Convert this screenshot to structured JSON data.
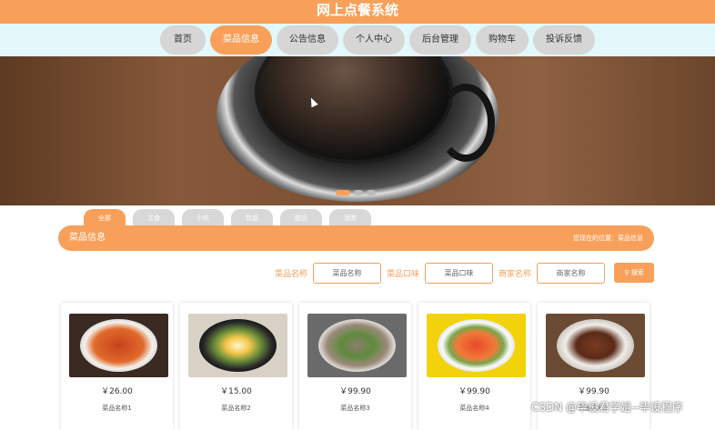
{
  "app_title": "网上点餐系统",
  "nav": {
    "items": [
      {
        "label": "首页"
      },
      {
        "label": "菜品信息",
        "active": true
      },
      {
        "label": "公告信息"
      },
      {
        "label": "个人中心"
      },
      {
        "label": "后台管理"
      },
      {
        "label": "购物车"
      },
      {
        "label": "投诉反馈"
      }
    ]
  },
  "carousel": {
    "slides": 3,
    "active_index": 0
  },
  "categories": [
    "全部",
    "主食",
    "小吃",
    "饮品",
    "甜品",
    "汤类"
  ],
  "section": {
    "title": "菜品信息",
    "breadcrumb": "您现在的位置：菜品信息"
  },
  "search": {
    "fields": [
      {
        "label": "菜品名称",
        "placeholder": "菜品名称"
      },
      {
        "label": "菜品口味",
        "placeholder": "菜品口味"
      },
      {
        "label": "商家名称",
        "placeholder": "商家名称"
      }
    ],
    "button_label": "搜索"
  },
  "dishes": [
    {
      "price": "￥26.00",
      "name": "菜品名称1"
    },
    {
      "price": "￥15.00",
      "name": "菜品名称2"
    },
    {
      "price": "￥99.90",
      "name": "菜品名称3"
    },
    {
      "price": "￥99.90",
      "name": "菜品名称4"
    },
    {
      "price": "￥99.90",
      "name": "菜品名称5"
    }
  ],
  "watermark": "CSDN @毕设君学姐--毕设程序",
  "colors": {
    "accent": "#f8a05a",
    "nav_bg": "#e3f8fb"
  }
}
